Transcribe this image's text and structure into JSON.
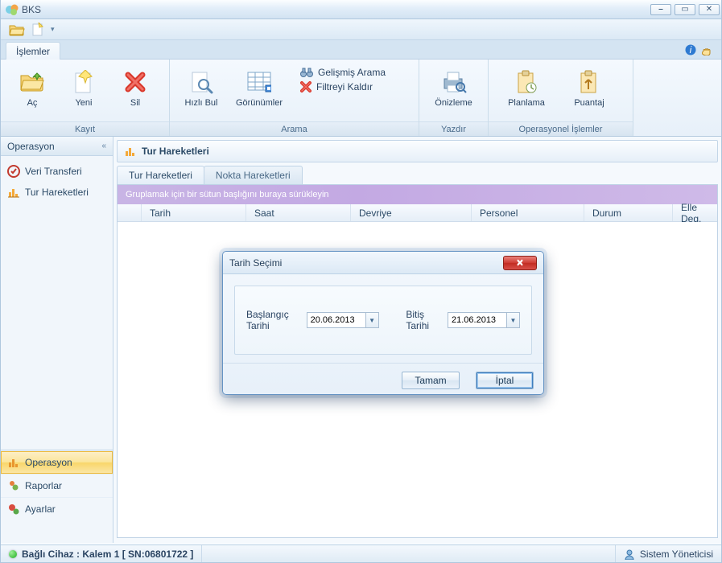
{
  "app": {
    "title": "BKS"
  },
  "ribbon": {
    "tab": "İşlemler",
    "groups": {
      "kayit": {
        "title": "Kayıt",
        "open": "Aç",
        "new": "Yeni",
        "delete": "Sil"
      },
      "arama": {
        "title": "Arama",
        "find": "Hızlı Bul",
        "views": "Görünümler",
        "adv": "Gelişmiş Arama",
        "clear": "Filtreyi Kaldır"
      },
      "yazdir": {
        "title": "Yazdır",
        "preview": "Önizleme"
      },
      "ops": {
        "title": "Operasyonel İşlemler",
        "plan": "Planlama",
        "puantaj": "Puantaj"
      }
    }
  },
  "sidebar": {
    "header": "Operasyon",
    "items": [
      {
        "label": "Veri Transferi"
      },
      {
        "label": "Tur Hareketleri"
      }
    ],
    "footer": [
      {
        "label": "Operasyon",
        "active": true
      },
      {
        "label": "Raporlar"
      },
      {
        "label": "Ayarlar"
      }
    ]
  },
  "main": {
    "title": "Tur Hareketleri",
    "tabs": [
      {
        "label": "Tur Hareketleri",
        "active": true
      },
      {
        "label": "Nokta Hareketleri",
        "active": false
      }
    ],
    "group_hint": "Gruplamak için bir sütun başlığını buraya sürükleyin",
    "columns": [
      "Tarih",
      "Saat",
      "Devriye",
      "Personel",
      "Durum",
      "Elle Deg."
    ]
  },
  "dialog": {
    "title": "Tarih Seçimi",
    "start_label": "Başlangıç Tarihi",
    "start_value": "20.06.2013",
    "end_label": "Bitiş Tarihi",
    "end_value": "21.06.2013",
    "ok": "Tamam",
    "cancel": "İptal"
  },
  "status": {
    "device": "Bağlı Cihaz : Kalem 1 [ SN:06801722 ]",
    "user": "Sistem Yöneticisi"
  },
  "colors": {
    "accent": "#e9b23b",
    "link": "#2b4a67"
  }
}
